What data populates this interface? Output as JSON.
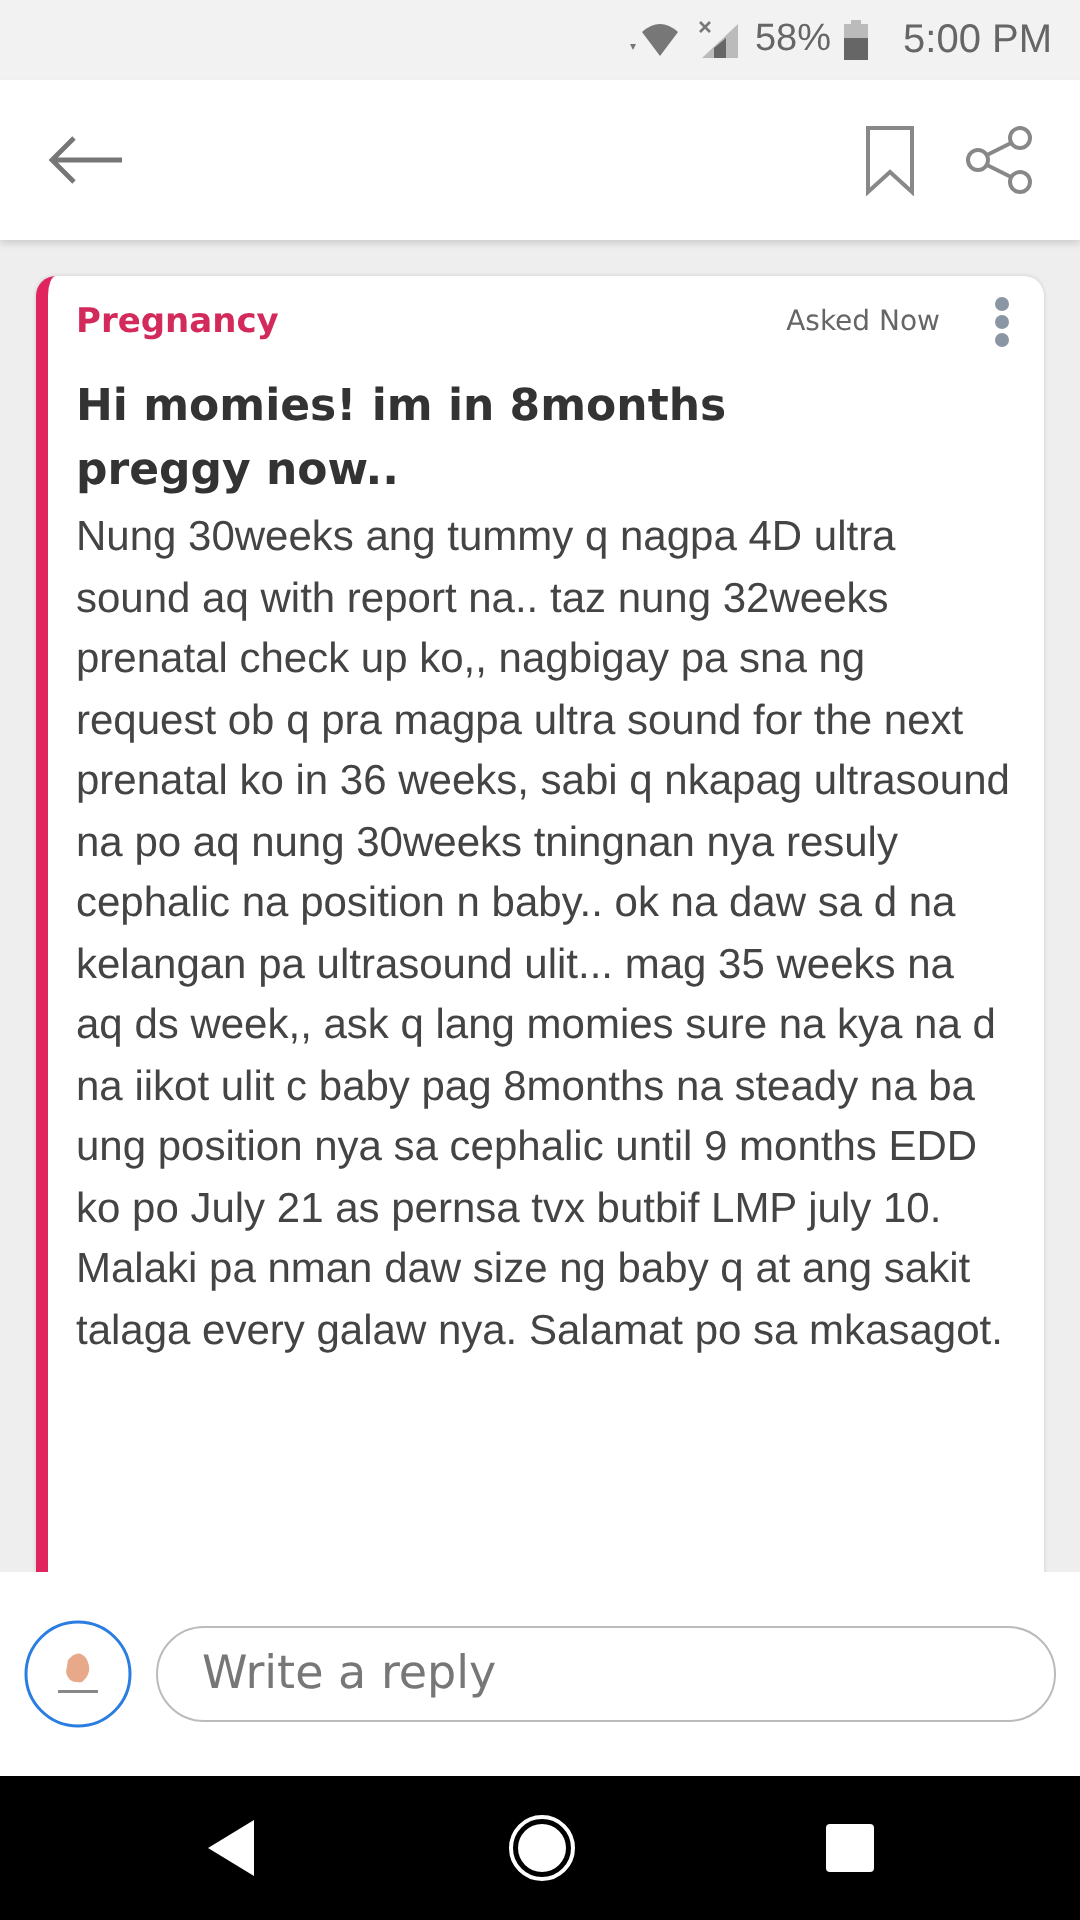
{
  "status_bar": {
    "battery": "58%",
    "time": "5:00 PM"
  },
  "post": {
    "category": "Pregnancy",
    "time": "Asked Now",
    "title": "Hi momies! im in 8months preggy now..",
    "body": "Nung 30weeks ang tummy q nagpa 4D ultra sound aq with report na.. taz nung 32weeks prenatal check up ko,, nagbigay pa sna ng request ob q pra magpa ultra sound for the next prenatal ko in 36 weeks, sabi q nkapag ultrasound na po aq nung 30weeks tningnan nya resuly cephalic na position n baby.. ok na daw sa d na kelangan pa ultrasound ulit... mag 35 weeks na aq ds week,, ask q lang momies sure na kya na d na iikot ulit c baby pag 8months na steady na ba ung position nya sa cephalic until 9 months EDD ko po July 21 as pernsa tvx butbif LMP july 10. Malaki pa nman daw size ng baby q at ang sakit talaga every galaw nya. Salamat po sa mkasagot."
  },
  "reply": {
    "placeholder": "Write a reply"
  }
}
